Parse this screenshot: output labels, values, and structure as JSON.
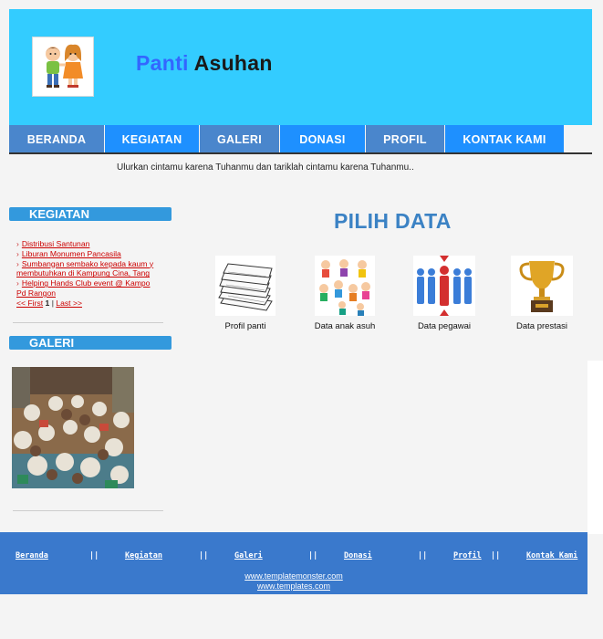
{
  "header": {
    "title_part1": "Panti",
    "title_part2": "Asuhan"
  },
  "nav": [
    {
      "label": "BERANDA",
      "color": "#4a86cc"
    },
    {
      "label": "KEGIATAN",
      "color": "#1e90ff"
    },
    {
      "label": "GALERI",
      "color": "#4a86cc"
    },
    {
      "label": "DONASI",
      "color": "#1e90ff"
    },
    {
      "label": "PROFIL",
      "color": "#4a86cc"
    },
    {
      "label": "KONTAK KAMI",
      "color": "#1e90ff"
    }
  ],
  "tagline": "Ulurkan cintamu karena Tuhanmu dan tariklah cintamu karena Tuhanmu..",
  "sidebar": {
    "kegiatan_title": "KEGIATAN",
    "posts": [
      [
        "Distribusi Santunan"
      ],
      [
        "Liburan Monumen Pancasila"
      ],
      [
        "Sumbangan sembako kepada kaum y",
        "membutuhkan di Kampung Cina, Tang"
      ],
      [
        "Helping Hands Club event @ Kampo",
        "Pd Rangon"
      ]
    ],
    "pager": {
      "first": "<< First",
      "page": "1",
      "sep": "|",
      "last": "Last >>"
    },
    "galeri_title": "GALERI"
  },
  "main": {
    "heading": "PILIH DATA",
    "cards": [
      {
        "label": "Profil panti",
        "icon": "papers-stack-icon"
      },
      {
        "label": "Data anak asuh",
        "icon": "children-icon"
      },
      {
        "label": "Data pegawai",
        "icon": "employees-icon"
      },
      {
        "label": "Data prestasi",
        "icon": "trophy-icon"
      }
    ]
  },
  "footer": {
    "nav": [
      "Beranda",
      "Kegiatan",
      "Galeri",
      "Donasi",
      "Profil",
      "Kontak Kami"
    ],
    "separator": "||",
    "link1": "www.templatemonster.com",
    "link2": "www.templates.com"
  },
  "colors": {
    "header_bg": "#33ccff",
    "footer_bg": "#3a79cc",
    "sidebar_head": "#3399dd",
    "heading": "#3b82c4"
  }
}
